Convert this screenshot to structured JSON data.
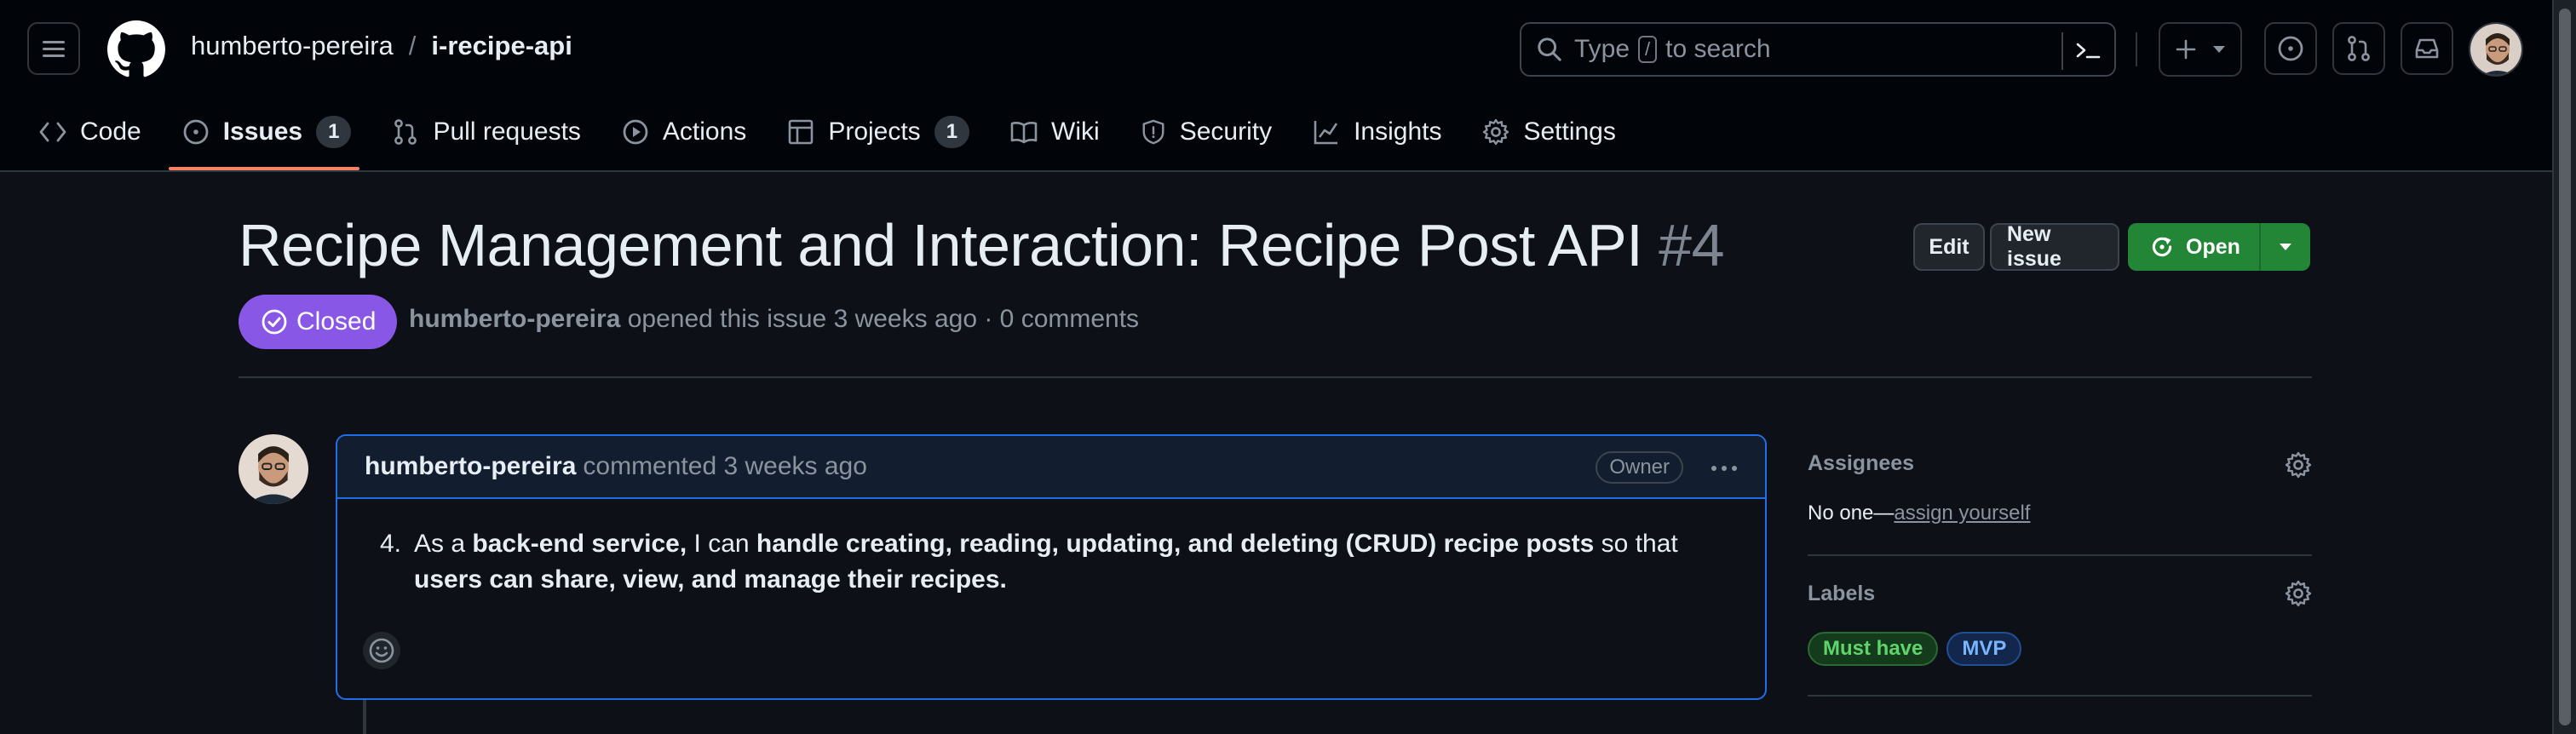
{
  "header": {
    "owner": "humberto-pereira",
    "separator": "/",
    "repo": "i-recipe-api",
    "search": {
      "prefix": "Type",
      "key": "/",
      "suffix": "to search"
    }
  },
  "nav": {
    "tabs": [
      {
        "label": "Code",
        "icon": "code-icon"
      },
      {
        "label": "Issues",
        "icon": "issue-opened-icon",
        "count": "1",
        "active": true
      },
      {
        "label": "Pull requests",
        "icon": "git-pull-request-icon"
      },
      {
        "label": "Actions",
        "icon": "play-icon"
      },
      {
        "label": "Projects",
        "icon": "table-icon",
        "count": "1"
      },
      {
        "label": "Wiki",
        "icon": "book-icon"
      },
      {
        "label": "Security",
        "icon": "shield-icon"
      },
      {
        "label": "Insights",
        "icon": "graph-icon"
      },
      {
        "label": "Settings",
        "icon": "gear-icon"
      }
    ]
  },
  "issue": {
    "title": "Recipe Management and Interaction: Recipe Post API",
    "number": "#4",
    "state": "Closed",
    "author": "humberto-pereira",
    "meta_text": "opened this issue 3 weeks ago · 0 comments",
    "actions": {
      "edit": "Edit",
      "new_issue": "New issue",
      "open": "Open"
    }
  },
  "comment": {
    "author": "humberto-pereira",
    "action": "commented 3 weeks ago",
    "role": "Owner",
    "list_number": "4.",
    "parts": {
      "p1": "As a ",
      "b1": "back-end service,",
      "p2": " I can ",
      "b2": "handle creating, reading, updating, and deleting (CRUD) recipe posts",
      "p3": " so that ",
      "b3": "users can share, view, and manage their recipes."
    }
  },
  "sidebar": {
    "assignees": {
      "heading": "Assignees",
      "text": "No one—",
      "link": "assign yourself"
    },
    "labels": {
      "heading": "Labels",
      "items": [
        {
          "name": "Must have",
          "color": "#5fd46a"
        },
        {
          "name": "MVP",
          "color": "#79b4ff"
        }
      ]
    }
  },
  "colors": {
    "background": "#0d1117",
    "closed_state": "#8957e5",
    "open_button": "#238636",
    "active_tab_underline": "#f78166",
    "comment_border": "#1f6feb"
  }
}
